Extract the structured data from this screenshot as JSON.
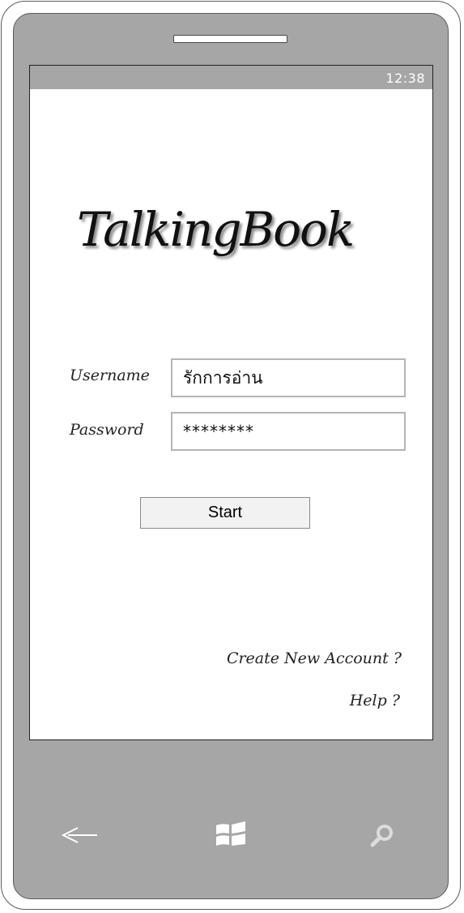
{
  "status_bar": {
    "time": "12:38"
  },
  "app": {
    "title": "TalkingBook"
  },
  "login_form": {
    "username_label": "Username",
    "username_value": "รักการอ่าน",
    "password_label": "Password",
    "password_value": "********",
    "start_label": "Start"
  },
  "links": {
    "create_account": "Create New Account ?",
    "help": "Help ?"
  },
  "hardware_keys": [
    {
      "name": "back",
      "icon": "back-arrow-icon"
    },
    {
      "name": "start",
      "icon": "windows-logo-icon"
    },
    {
      "name": "search",
      "icon": "search-icon"
    }
  ],
  "colors": {
    "phone_body": "#a6a6a6",
    "screen": "#ffffff",
    "status_bar": "#a6a6a6",
    "input_border": "#b5b5b5",
    "button_bg": "#f2f2f2"
  }
}
